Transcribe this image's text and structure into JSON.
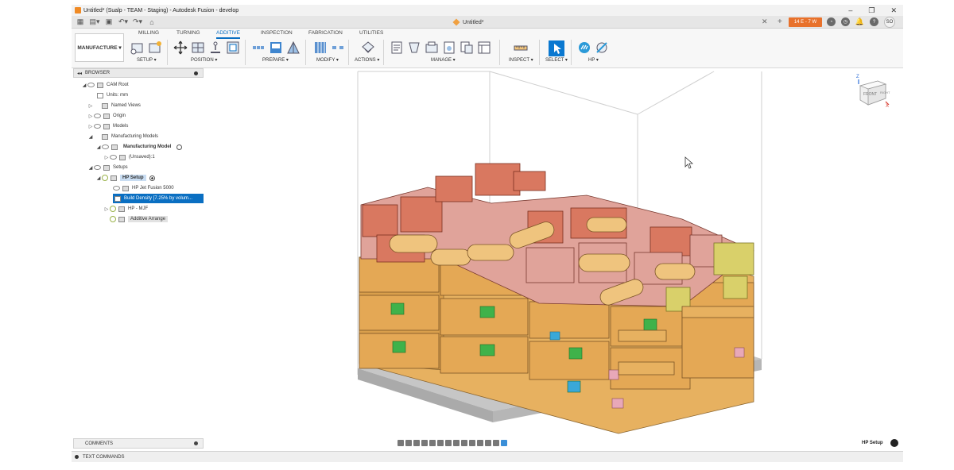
{
  "window": {
    "title": "Untitled* (Sualp - TEAM - Staging) - Autodesk Fusion - develop",
    "doc_tab": "Untitled*",
    "badge": "14 E - 7 W",
    "avatar": "SO"
  },
  "ribbon": {
    "workspace": "MANUFACTURE",
    "tabs": [
      "MILLING",
      "TURNING",
      "ADDITIVE",
      "INSPECTION",
      "FABRICATION",
      "UTILITIES"
    ],
    "active_tab": "ADDITIVE",
    "groups": [
      "SETUP",
      "POSITION",
      "PREPARE",
      "MODIFY",
      "ACTIONS",
      "MANAGE",
      "INSPECT",
      "SELECT",
      "HP"
    ]
  },
  "browser": {
    "title": "BROWSER",
    "nodes": [
      {
        "label": "CAM Root"
      },
      {
        "label": "Units: mm"
      },
      {
        "label": "Named Views"
      },
      {
        "label": "Origin"
      },
      {
        "label": "Models"
      },
      {
        "label": "Manufacturing Models"
      },
      {
        "label": "Manufacturing Model"
      },
      {
        "label": "(Unsaved):1"
      },
      {
        "label": "Setups"
      },
      {
        "label": "HP Setup"
      },
      {
        "label": "HP Jet Fusion 5000"
      },
      {
        "label": "Build Density [7.25% by volum..."
      },
      {
        "label": "HP - MJF"
      },
      {
        "label": "Additive Arrange"
      }
    ]
  },
  "viewcube": {
    "face": "FRONT",
    "side": "RIGHT",
    "axis_z": "Z",
    "axis_x": "X"
  },
  "bottom": {
    "comments": "COMMENTS",
    "text_commands": "TEXT COMMANDS",
    "status_setup": "HP Setup"
  },
  "colors": {
    "accent": "#0a6fc2",
    "badge": "#e8712b",
    "part_tan": "#e7b160",
    "part_red": "#d97860",
    "part_pink": "#e0a39a",
    "part_green": "#3fb24a",
    "part_yellow": "#d9d06a",
    "plate": "#c9c9c9"
  }
}
